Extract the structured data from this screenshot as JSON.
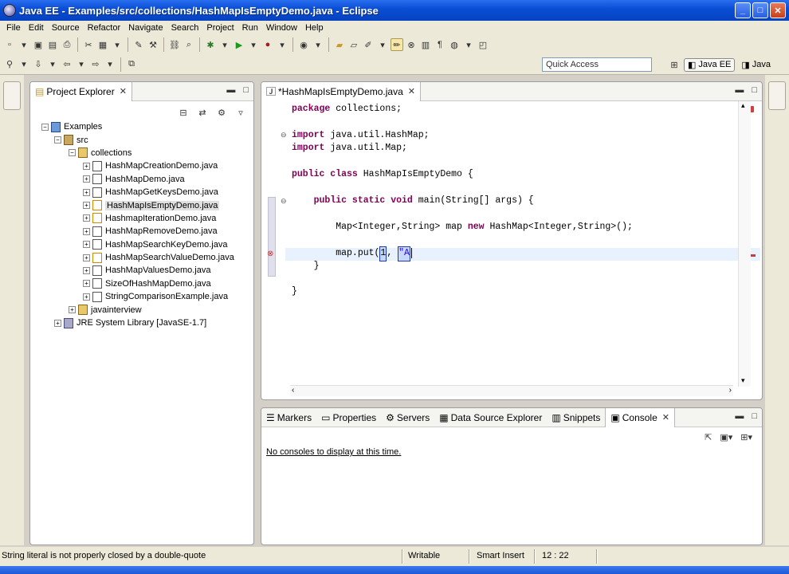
{
  "window": {
    "title": "Java EE - Examples/src/collections/HashMapIsEmptyDemo.java - Eclipse",
    "min": "_",
    "max": "□",
    "close": "✕"
  },
  "menu": [
    "File",
    "Edit",
    "Source",
    "Refactor",
    "Navigate",
    "Search",
    "Project",
    "Run",
    "Window",
    "Help"
  ],
  "toolbar": {
    "quick_access": "Quick Access",
    "perspective_javaee": "Java EE",
    "perspective_java": "Java"
  },
  "explorer": {
    "tab_label": "Project Explorer",
    "tree": {
      "project": "Examples",
      "src": "src",
      "package": "collections",
      "files": [
        "HashMapCreationDemo.java",
        "HashMapDemo.java",
        "HashMapGetKeysDemo.java",
        "HashMapIsEmptyDemo.java",
        "HashmapIterationDemo.java",
        "HashMapRemoveDemo.java",
        "HashMapSearchKeyDemo.java",
        "HashMapSearchValueDemo.java",
        "HashMapValuesDemo.java",
        "SizeOfHashMapDemo.java",
        "StringComparisonExample.java"
      ],
      "package2": "javainterview",
      "library": "JRE System Library [JavaSE-1.7]"
    }
  },
  "editor": {
    "tab_label": "*HashMapIsEmptyDemo.java",
    "lines": {
      "l1a": "package",
      "l1b": " collections;",
      "l3a": "import",
      "l3b": " java.util.HashMap;",
      "l4a": "import",
      "l4b": " java.util.Map;",
      "l6a": "public class",
      "l6b": " HashMapIsEmptyDemo {",
      "l8pre": "    ",
      "l8a": "public static void",
      "l8b": " main(String[] args) {",
      "l10pre": "        Map<Integer,String> map ",
      "l10a": "new",
      "l10b": " HashMap<Integer,String>();",
      "l12pre": "        map.put(",
      "l12c1": "1",
      "l12mid": ", ",
      "l12c2": "\"A",
      "l13": "    }",
      "l15": "}"
    }
  },
  "console": {
    "tabs": [
      "Markers",
      "Properties",
      "Servers",
      "Data Source Explorer",
      "Snippets",
      "Console"
    ],
    "message": "No consoles to display at this time."
  },
  "status": {
    "message": "String literal is not properly closed by a double-quote",
    "writable": "Writable",
    "insert": "Smart Insert",
    "position": "12 : 22"
  }
}
